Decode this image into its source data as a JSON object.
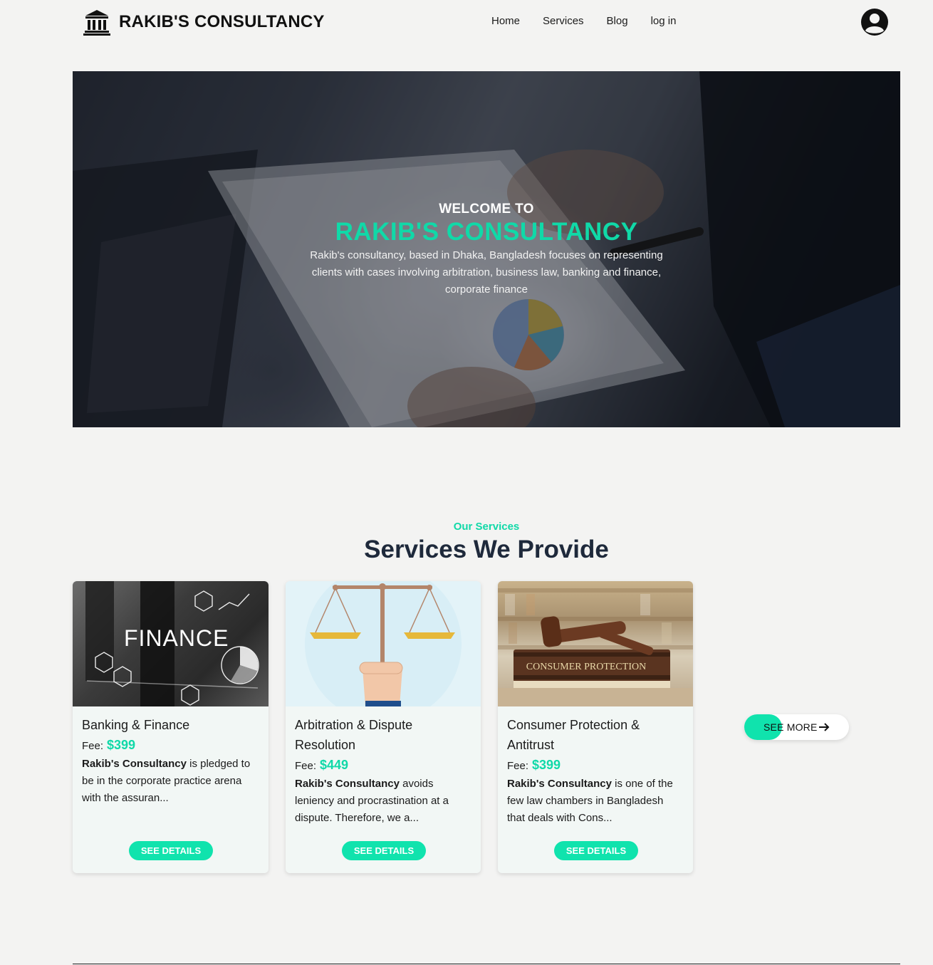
{
  "nav": {
    "brand": "RAKIB'S CONSULTANCY",
    "brand_icon": "bank-building-icon",
    "links": [
      "Home",
      "Services",
      "Blog",
      "log in"
    ],
    "avatar_icon": "user-circle-icon"
  },
  "hero": {
    "welcome": "WELCOME TO",
    "title": "RAKIB'S CONSULTANCY",
    "description": "Rakib's consultancy, based in Dhaka, Bangladesh focuses on representing clients with cases involving arbitration, business law, banking and finance, corporate finance"
  },
  "services": {
    "kicker": "Our Services",
    "title": "Services We Provide",
    "fee_label": "Fee:",
    "details_label": "SEE DETAILS",
    "cards": [
      {
        "title": "Banking & Finance",
        "fee": "$399",
        "desc_bold": "Rakib's Consultancy",
        "desc_rest": " is pledged to be in the corporate practice arena with the assuran...",
        "image_text": "FINANCE"
      },
      {
        "title": "Arbitration & Dispute Resolution",
        "fee": "$449",
        "desc_bold": "Rakib's Consultancy",
        "desc_rest": " avoids leniency and procrastination at a dispute. Therefore, we a..."
      },
      {
        "title": "Consumer Protection & Antitrust",
        "fee": "$399",
        "desc_bold": "Rakib's Consultancy",
        "desc_rest": " is one of the few law chambers in Bangladesh that deals with Cons...",
        "image_text": "CONSUMER PROTECTION"
      }
    ],
    "see_more": "SEE MORE",
    "see_more_icon": "arrow-right-icon"
  },
  "colors": {
    "accent": "#10d9a8",
    "button": "#10e3ad",
    "heading": "#1e293b",
    "background": "#f3f3f2"
  }
}
